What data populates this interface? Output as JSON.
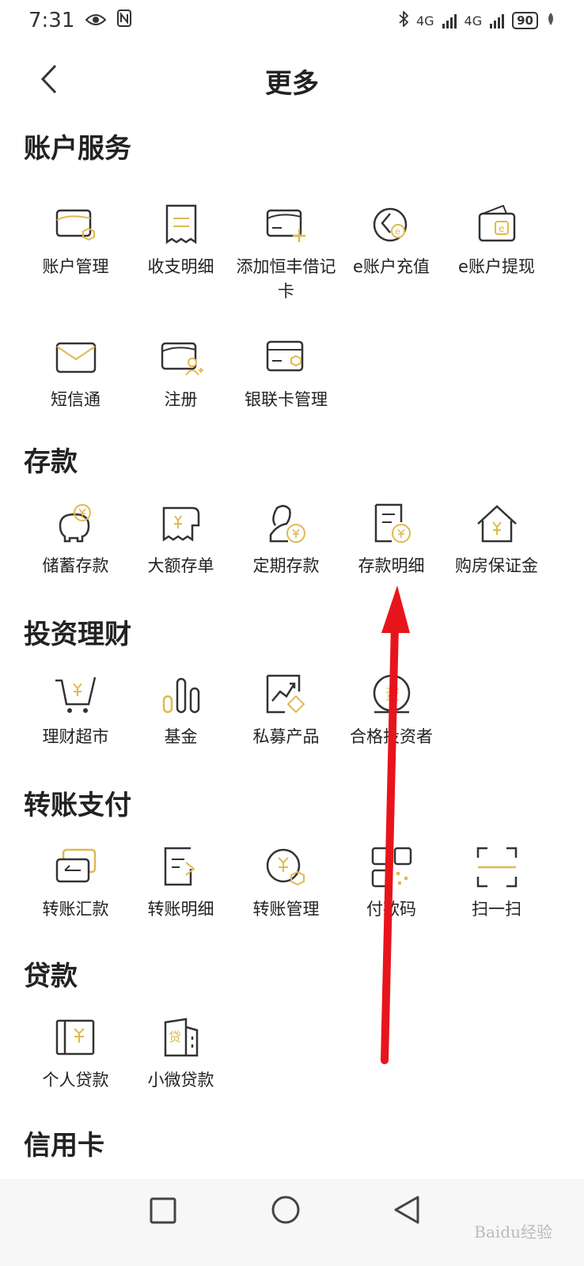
{
  "status_bar": {
    "time": "7:31",
    "battery": "90",
    "network": "4G"
  },
  "header": {
    "title": "更多"
  },
  "sections": [
    {
      "title": "账户服务",
      "items": [
        {
          "label": "账户管理",
          "icon": "account-card-shield-icon"
        },
        {
          "label": "收支明细",
          "icon": "receipt-icon"
        },
        {
          "label": "添加恒丰借记卡",
          "icon": "add-card-icon"
        },
        {
          "label": "e账户充值",
          "icon": "e-recharge-icon"
        },
        {
          "label": "e账户提现",
          "icon": "e-wallet-icon"
        },
        {
          "label": "短信通",
          "icon": "envelope-icon"
        },
        {
          "label": "注册",
          "icon": "register-user-icon"
        },
        {
          "label": "银联卡管理",
          "icon": "unionpay-card-icon"
        }
      ]
    },
    {
      "title": "存款",
      "items": [
        {
          "label": "储蓄存款",
          "icon": "piggy-bank-icon"
        },
        {
          "label": "大额存单",
          "icon": "large-deposit-icon"
        },
        {
          "label": "定期存款",
          "icon": "fixed-deposit-icon"
        },
        {
          "label": "存款明细",
          "icon": "deposit-detail-icon"
        },
        {
          "label": "购房保证金",
          "icon": "house-deposit-icon"
        }
      ]
    },
    {
      "title": "投资理财",
      "items": [
        {
          "label": "理财超市",
          "icon": "cart-icon"
        },
        {
          "label": "基金",
          "icon": "fund-bars-icon"
        },
        {
          "label": "私募产品",
          "icon": "private-fund-icon"
        },
        {
          "label": "合格投资者",
          "icon": "qualified-investor-icon"
        }
      ]
    },
    {
      "title": "转账支付",
      "items": [
        {
          "label": "转账汇款",
          "icon": "transfer-icon"
        },
        {
          "label": "转账明细",
          "icon": "transfer-detail-icon"
        },
        {
          "label": "转账管理",
          "icon": "transfer-manage-icon"
        },
        {
          "label": "付款码",
          "icon": "payment-code-icon"
        },
        {
          "label": "扫一扫",
          "icon": "scan-icon"
        }
      ]
    },
    {
      "title": "贷款",
      "items": [
        {
          "label": "个人贷款",
          "icon": "personal-loan-icon"
        },
        {
          "label": "小微贷款",
          "icon": "micro-loan-icon"
        }
      ]
    },
    {
      "title": "信用卡",
      "items": []
    }
  ],
  "watermark": "Baidu经验",
  "colors": {
    "accent": "#E0B94E",
    "annotation_arrow": "#E8141B",
    "text": "#222222"
  }
}
